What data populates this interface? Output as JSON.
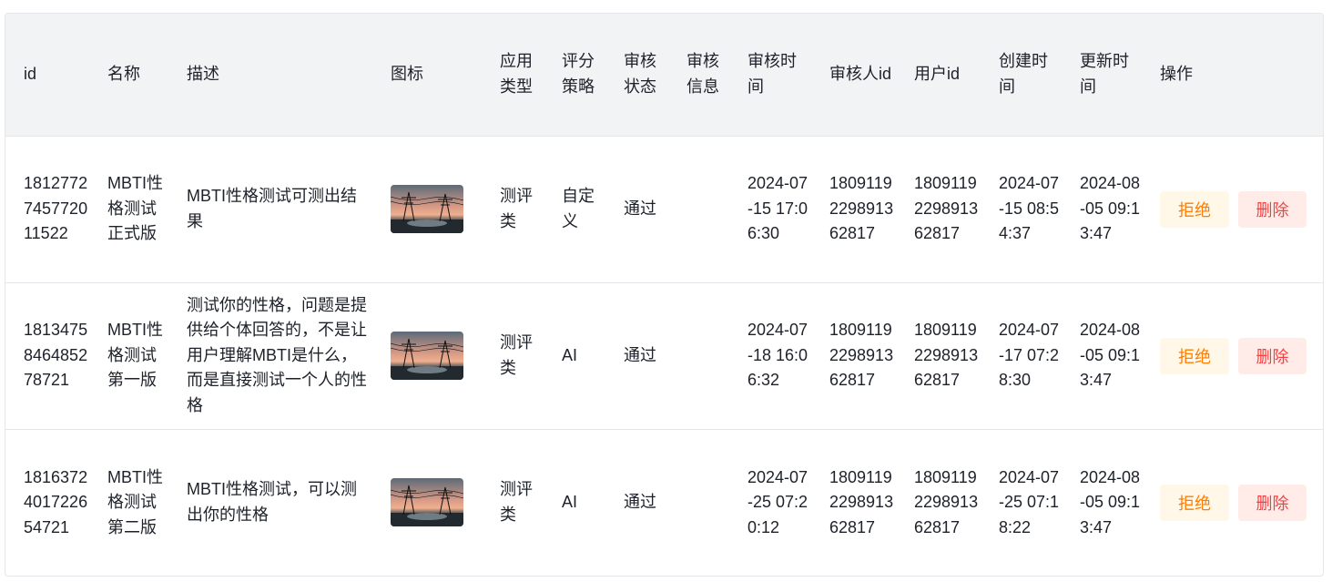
{
  "table": {
    "columns": [
      {
        "key": "id",
        "label": "id"
      },
      {
        "key": "name",
        "label": "名称"
      },
      {
        "key": "desc",
        "label": "描述"
      },
      {
        "key": "icon",
        "label": "图标"
      },
      {
        "key": "app_type",
        "label": "应用类型"
      },
      {
        "key": "scoring",
        "label": "评分策略"
      },
      {
        "key": "review_status",
        "label": "审核状态"
      },
      {
        "key": "review_message",
        "label": "审核信息"
      },
      {
        "key": "review_time",
        "label": "审核时间"
      },
      {
        "key": "reviewer_id",
        "label": "审核人id"
      },
      {
        "key": "user_id",
        "label": "用户id"
      },
      {
        "key": "create_time",
        "label": "创建时间"
      },
      {
        "key": "update_time",
        "label": "更新时间"
      },
      {
        "key": "actions",
        "label": "操作"
      }
    ],
    "rows": [
      {
        "id": "1812772745772011522",
        "name": "MBTI性格测试正式版",
        "desc": "MBTI性格测试可测出结果",
        "icon": "power-lines-sunset-image",
        "app_type": "测评类",
        "scoring": "自定义",
        "review_status": "通过",
        "review_message": "",
        "review_time": "2024-07-15 17:06:30",
        "reviewer_id": "1809119229891362817",
        "user_id": "1809119229891362817",
        "create_time": "2024-07-15 08:54:37",
        "update_time": "2024-08-05 09:13:47",
        "reject_label": "拒绝",
        "delete_label": "删除"
      },
      {
        "id": "1813475846485278721",
        "name": "MBTI性格测试第一版",
        "desc": "测试你的性格，问题是提供给个体回答的，不是让用户理解MBTI是什么，而是直接测试一个人的性格",
        "icon": "power-lines-sunset-image",
        "app_type": "测评类",
        "scoring": "AI",
        "review_status": "通过",
        "review_message": "",
        "review_time": "2024-07-18 16:06:32",
        "reviewer_id": "1809119229891362817",
        "user_id": "1809119229891362817",
        "create_time": "2024-07-17 07:28:30",
        "update_time": "2024-08-05 09:13:47",
        "reject_label": "拒绝",
        "delete_label": "删除"
      },
      {
        "id": "1816372401722654721",
        "name": "MBTI性格测试第二版",
        "desc": "MBTI性格测试，可以测出你的性格",
        "icon": "power-lines-sunset-image",
        "app_type": "测评类",
        "scoring": "AI",
        "review_status": "通过",
        "review_message": "",
        "review_time": "2024-07-25 07:20:12",
        "reviewer_id": "1809119229891362817",
        "user_id": "1809119229891362817",
        "create_time": "2024-07-25 07:18:22",
        "update_time": "2024-08-05 09:13:47",
        "reject_label": "拒绝",
        "delete_label": "删除"
      }
    ]
  },
  "colors": {
    "header_bg": "#f2f3f5",
    "border": "#e5e6eb",
    "reject_bg": "#fff7e8",
    "reject_text": "#ff7d00",
    "delete_bg": "#ffece8",
    "delete_text": "#f53f3f"
  }
}
